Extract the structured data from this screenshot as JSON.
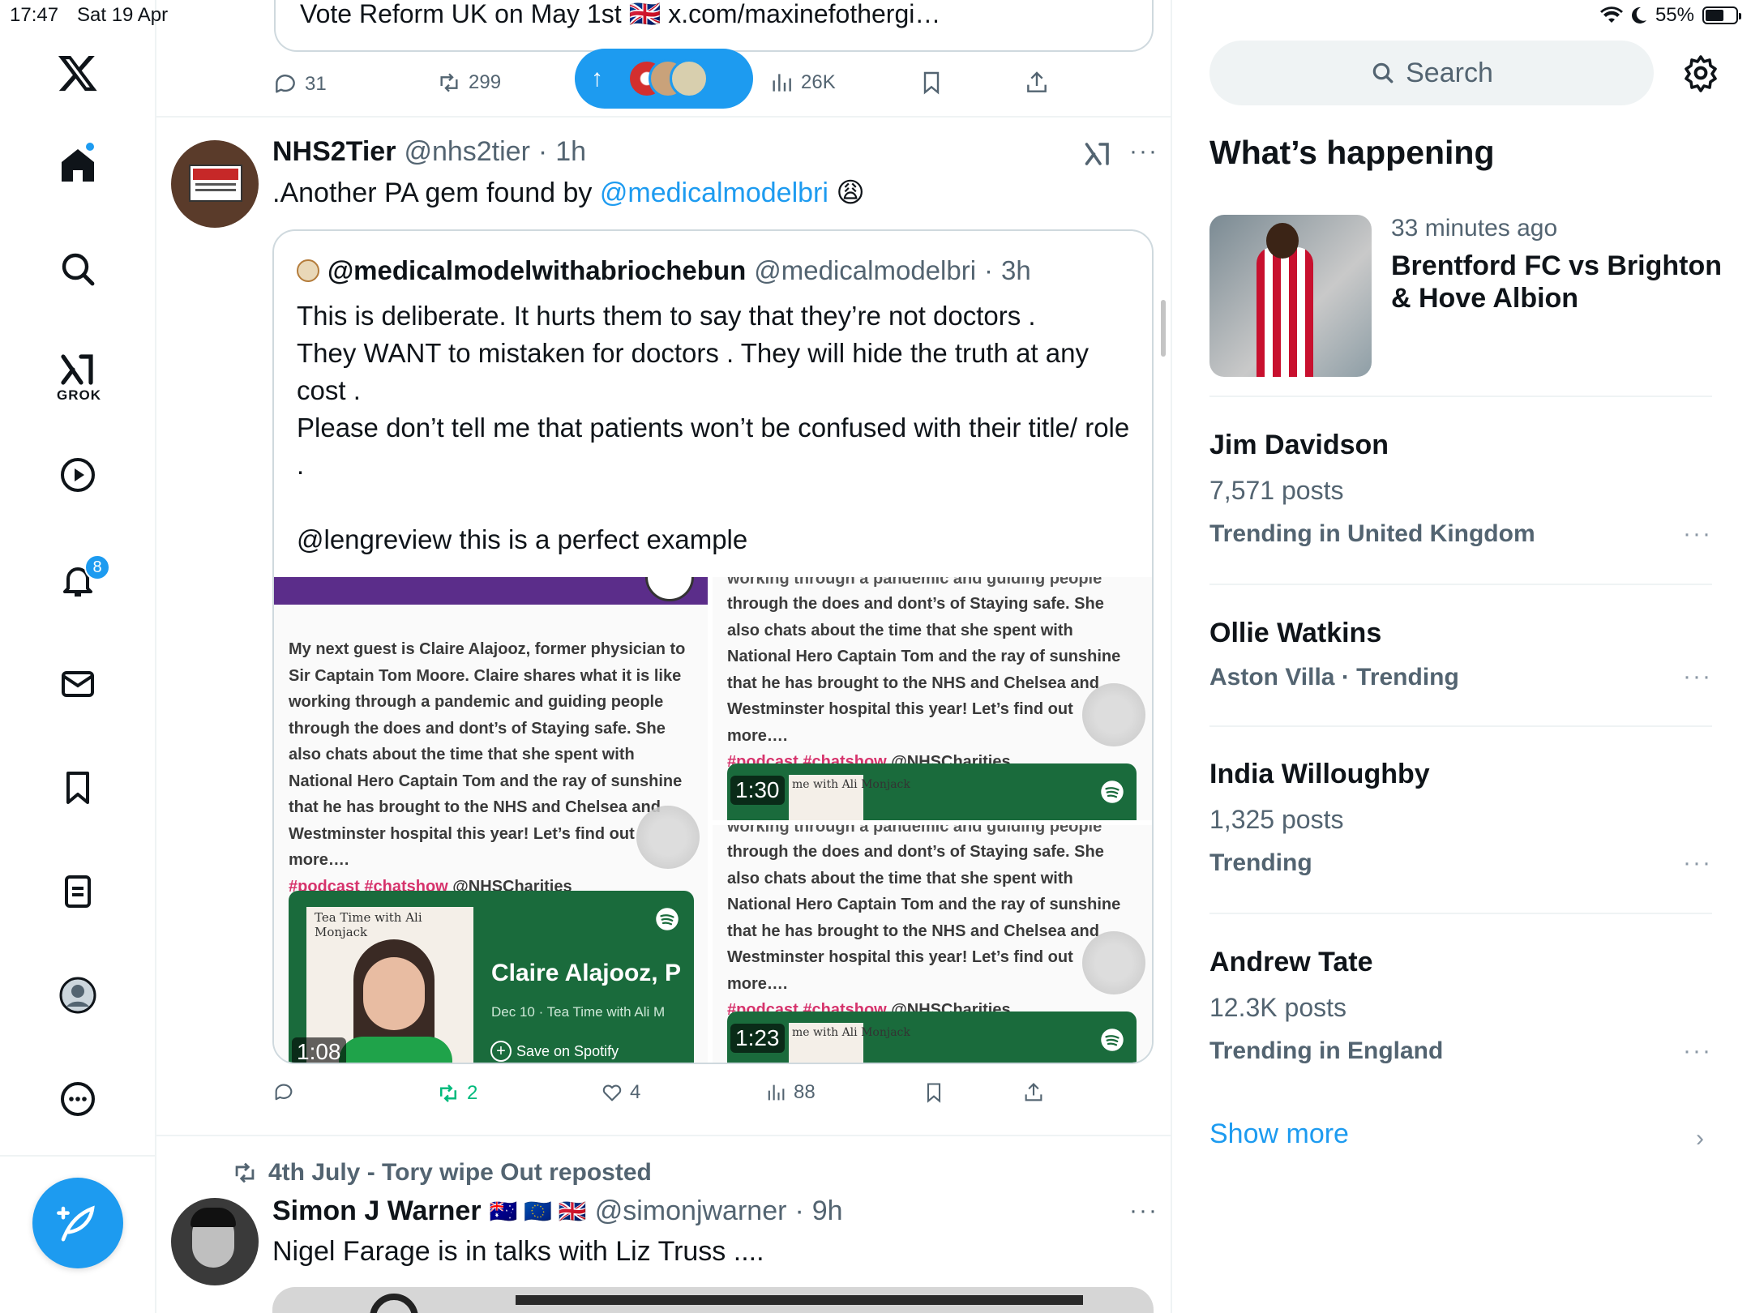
{
  "status_bar": {
    "time": "17:47",
    "date": "Sat 19 Apr",
    "battery": "55%"
  },
  "nav": {
    "grok_label": "GROK",
    "notifications_badge": "8",
    "accent_color": "#1d9bf0"
  },
  "prev_tweet": {
    "text": "Vote Reform UK on May 1st 🇬🇧 x.com/maxinefothergi…",
    "replies": "31",
    "reposts": "299",
    "views": "26K"
  },
  "new_posts_pill": {
    "arrow": "↑"
  },
  "tweet": {
    "name": "NHS2Tier",
    "handle": "@nhs2tier",
    "sep": "·",
    "time": "1h",
    "text_prefix": ".Another PA gem found by ",
    "text_mention": "@medicalmodelbri",
    "text_emoji": "😩",
    "quote": {
      "name": "@medicalmodelwithabriochebun",
      "handle": "@medicalmodelbri",
      "sep": "·",
      "time": "3h",
      "text": "This is deliberate. It hurts them to say that they’re not doctors .\nThey WANT to mistaken for doctors . They will hide the truth at any cost .\nPlease don’t tell me that patients won’t be confused with their title/ role .\n\n@lengreview this is a perfect example",
      "image_left": {
        "body": "My next guest is Claire Alajooz, former physician to Sir Captain Tom Moore. Claire shares what it is like working through a pandemic and guiding people through the does and dont’s of Staying safe. She also chats about the time that she spent with National Hero Captain Tom and the ray of sunshine that he has brought to the NHS and Chelsea and Westminster hospital this year! Let’s find out more….",
        "tags": "#podcast #chatshow",
        "tag_handle": "@NHSCharities",
        "spotify_show": "Tea Time with Ali Monjack",
        "spotify_title": "Claire Alajooz, P",
        "spotify_meta": "Dec 10 · Tea Time with Ali M",
        "spotify_save": "Save on Spotify",
        "duration": "1:08"
      },
      "image_right_top": {
        "cut_line": "working through a pandemic and guiding people",
        "body": "through the does and dont’s of Staying safe. She also chats about the time that she spent with National Hero Captain Tom and the ray of sunshine that he has brought to the NHS and Chelsea and Westminster hospital this year! Let’s find out more….",
        "tags": "#podcast #chatshow",
        "tag_handle": "@NHSCharities",
        "spotify_show": "me with Ali Monjack",
        "duration": "1:30"
      },
      "image_right_bottom": {
        "cut_line": "working through a pandemic and guiding people",
        "body": "through the does and dont’s of Staying safe. She also chats about the time that she spent with National Hero Captain Tom and the ray of sunshine that he has brought to the NHS and Chelsea and Westminster hospital this year! Let’s find out more….",
        "tags": "#podcast #chatshow",
        "tag_handle": "@NHSCharities",
        "spotify_show": "me with Ali Monjack",
        "duration": "1:23"
      }
    },
    "reposts": "2",
    "likes": "4",
    "views": "88"
  },
  "next_tweet": {
    "repost_label": "4th July - Tory wipe Out reposted",
    "name": "Simon J Warner",
    "flags": "🇦🇺 🇪🇺 🇬🇧",
    "handle": "@simonjwarner",
    "sep": "·",
    "time": "9h",
    "text": "Nigel Farage is in talks with Liz Truss ...."
  },
  "right": {
    "search_placeholder": "Search",
    "title": "What’s happening",
    "news": {
      "meta": "33 minutes ago",
      "title": "Brentford FC vs Brighton & Hove Albion"
    },
    "trends": [
      {
        "name": "Jim Davidson",
        "count": "7,571 posts",
        "context": "Trending in United Kingdom"
      },
      {
        "name": "Ollie Watkins",
        "context": "Aston Villa · Trending"
      },
      {
        "name": "India Willoughby",
        "count": "1,325 posts",
        "context": "Trending"
      },
      {
        "name": "Andrew Tate",
        "count": "12.3K posts",
        "context": "Trending in England"
      }
    ],
    "show_more": "Show more",
    "dots": "···"
  }
}
